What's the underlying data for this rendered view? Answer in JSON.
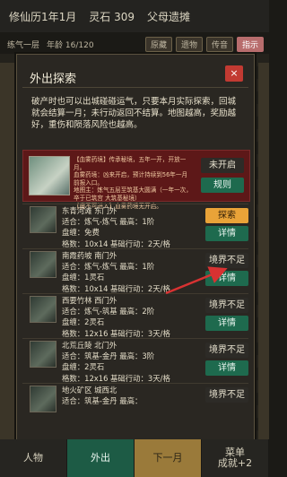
{
  "topbar": {
    "date": "修仙历1年1月",
    "spirit_stone": "灵石 309",
    "title": "父母遗摊"
  },
  "subbar": {
    "realm": "练气一层",
    "age": "年龄 16/120",
    "tags": [
      "原藏",
      "遗物",
      "传音",
      "指示"
    ]
  },
  "modal": {
    "title": "外出探索",
    "close": "×",
    "intro": "破产时也可以出城碰碰运气，只要本月实际探索，回城就会结算一月；未行动返回不结算。地图越高，奖励越好，重伤和陨落风险也越高。",
    "featured": {
      "desc": "【血雾药境】传承秘境，五年一开，开放一月。\n血雾药境：凶来开启，预计持续到56年一月前报入口。\n地图主：炼气五层至筑基大圆满（一年一次，卒于已筑宫 大筑基秘境）\n【魔不可进入】血雾药境无开启。",
      "status": "未开启",
      "rules": "规则"
    },
    "places": [
      {
        "name": "东青河滩  东门外",
        "suitable": "适合：炼气-炼气  最高：1阶",
        "output": "盘缠：免费",
        "terrain": "格数：10x14  基础行动：2天/格",
        "action": "探索",
        "detail": "详情"
      },
      {
        "name": "南霞药坡  南门外",
        "suitable": "适合：炼气-炼气  最高：1阶",
        "output": "盘缠：1灵石",
        "terrain": "格数：10x14  基础行动：2天/格",
        "action": "境界不足",
        "detail": "详情"
      },
      {
        "name": "西要竹林  西门外",
        "suitable": "适合：炼气-筑基  最高：2阶",
        "output": "盘缠：2灵石",
        "terrain": "格数：12x16  基础行动：3天/格",
        "action": "境界不足",
        "detail": "详情"
      },
      {
        "name": "北荒丘陵  北门外",
        "suitable": "适合：筑基-金丹  最高：3阶",
        "output": "盘缠：2灵石",
        "terrain": "格数：12x16  基础行动：3天/格",
        "action": "境界不足",
        "detail": "详情"
      },
      {
        "name": "地火矿区  城西北",
        "suitable": "适合：筑基-金丹  最高：",
        "output": "",
        "terrain": "",
        "action": "境界不足",
        "detail": ""
      }
    ]
  },
  "bottomnav": {
    "items": [
      "人物",
      "外出",
      "下一月",
      "菜单\n成就+2"
    ]
  },
  "colors": {
    "accent_green": "#1e6a4e",
    "accent_orange": "#e9a338",
    "danger_red": "#c23a32"
  },
  "icons": {
    "arrow": "red-arrow-icon"
  }
}
